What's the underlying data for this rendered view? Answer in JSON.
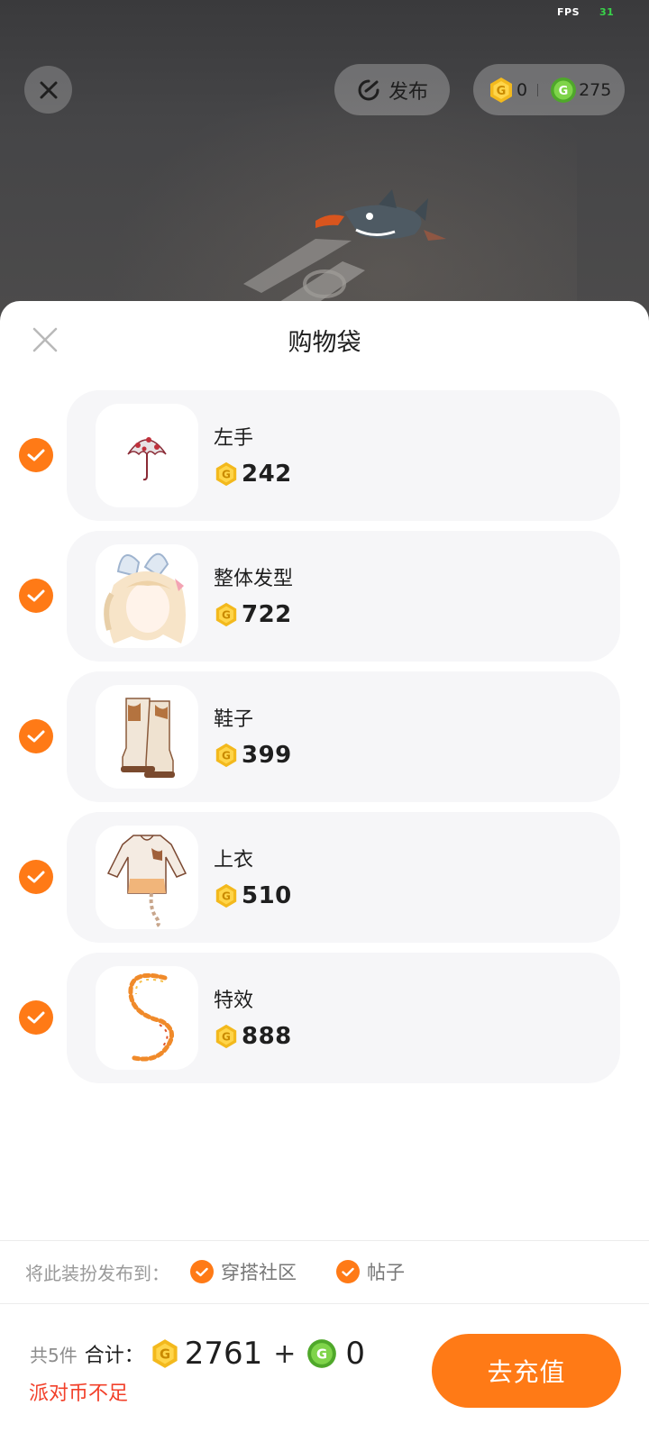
{
  "status": {
    "fps_label": "FPS",
    "fps_value": "31"
  },
  "header": {
    "publish_label": "发布",
    "gold_coin_amount": "0",
    "green_coin_amount": "275"
  },
  "sheet": {
    "title": "购物袋",
    "items": [
      {
        "name": "左手",
        "price": "242",
        "checked": true,
        "thumbnail_icon": "umbrella-icon"
      },
      {
        "name": "整体发型",
        "price": "722",
        "checked": true,
        "thumbnail_icon": "hairstyle-icon"
      },
      {
        "name": "鞋子",
        "price": "399",
        "checked": true,
        "thumbnail_icon": "boots-icon"
      },
      {
        "name": "上衣",
        "price": "510",
        "checked": true,
        "thumbnail_icon": "top-icon"
      },
      {
        "name": "特效",
        "price": "888",
        "checked": true,
        "thumbnail_icon": "effect-icon"
      }
    ]
  },
  "publish_to": {
    "label": "将此装扮发布到：",
    "options": [
      {
        "label": "穿搭社区",
        "checked": true
      },
      {
        "label": "帖子",
        "checked": true
      }
    ]
  },
  "footer": {
    "count_text": "共5件",
    "total_label": "合计：",
    "gold_total": "2761",
    "plus": "+",
    "green_total": "0",
    "warning": "派对币不足",
    "recharge_label": "去充值"
  },
  "colors": {
    "accent": "#ff7a16",
    "warning": "#f2402a",
    "gold_coin": "#f3b91d",
    "green_coin": "#6cc23a"
  }
}
